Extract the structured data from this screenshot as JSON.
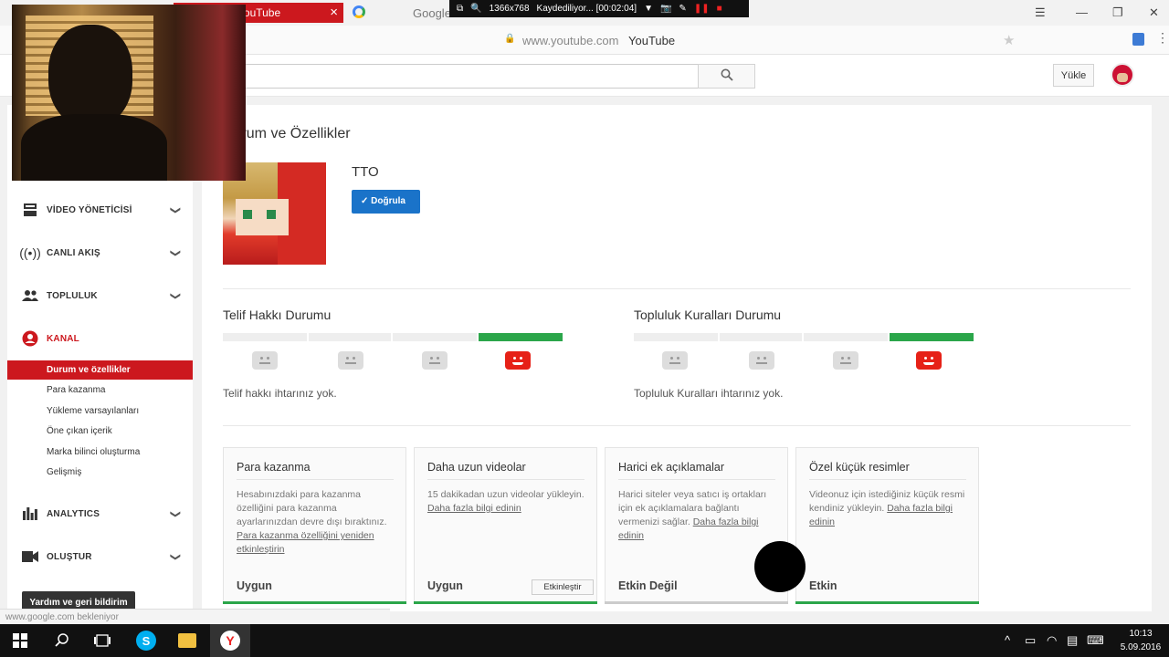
{
  "browser": {
    "tab_youtube": "YouTube",
    "tab_google": "Google",
    "url": "www.youtube.com",
    "page_title": "YouTube",
    "recorder_resolution": "1366x768",
    "recorder_status": "Kaydediliyor... [00:02:04]"
  },
  "header": {
    "upload_label": "Yükle"
  },
  "sidebar": {
    "video_manager": "VİDEO YÖNETİCİSİ",
    "live": "CANLI AKIŞ",
    "community": "TOPLULUK",
    "channel": "KANAL",
    "sub_items": [
      "Durum ve özellikler",
      "Para kazanma",
      "Yükleme varsayılanları",
      "Öne çıkan içerik",
      "Marka bilinci oluşturma",
      "Gelişmiş"
    ],
    "analytics": "ANALYTICS",
    "create": "OLUŞTUR",
    "help": "Yardım ve geri bildirim"
  },
  "main": {
    "title": "Durum ve Özellikler",
    "channel_name": "TTO",
    "verify_label": "Doğrula",
    "copyright": {
      "title": "Telif Hakkı Durumu",
      "desc": "Telif hakkı ihtarınız yok.",
      "level": 4
    },
    "community": {
      "title": "Topluluk Kuralları Durumu",
      "desc": "Topluluk Kuralları ihtarınız yok.",
      "level": 4
    },
    "cards": [
      {
        "title": "Para kazanma",
        "desc": "Hesabınızdaki para kazanma özelliğini para kazanma ayarlarınızdan devre dışı bıraktınız.",
        "link": "Para kazanma özelliğini yeniden etkinleştirin",
        "status": "Uygun",
        "status_color": "#2ba64a"
      },
      {
        "title": "Daha uzun videolar",
        "desc": "15 dakikadan uzun videolar yükleyin.",
        "link": "Daha fazla bilgi edinin",
        "status": "Uygun",
        "action": "Etkinleştir",
        "status_color": "#2ba64a"
      },
      {
        "title": "Harici ek açıklamalar",
        "desc": "Harici siteler veya satıcı iş ortakları için ek açıklamalara bağlantı vermenizi sağlar.",
        "link": "Daha fazla bilgi edinin",
        "status": "Etkin Değil",
        "status_color": "#cccccc"
      },
      {
        "title": "Özel küçük resimler",
        "desc": "Videonuz için istediğiniz küçük resmi kendiniz yükleyin.",
        "link": "Daha fazla bilgi edinin",
        "status": "Etkin",
        "status_color": "#2ba64a"
      }
    ]
  },
  "statusbar": {
    "text": "www.google.com bekleniyor"
  },
  "taskbar": {
    "time": "10:13",
    "date": "5.09.2016"
  },
  "colors": {
    "accent": "#cc181e",
    "verify": "#1a73c9",
    "ok": "#2ba64a"
  }
}
